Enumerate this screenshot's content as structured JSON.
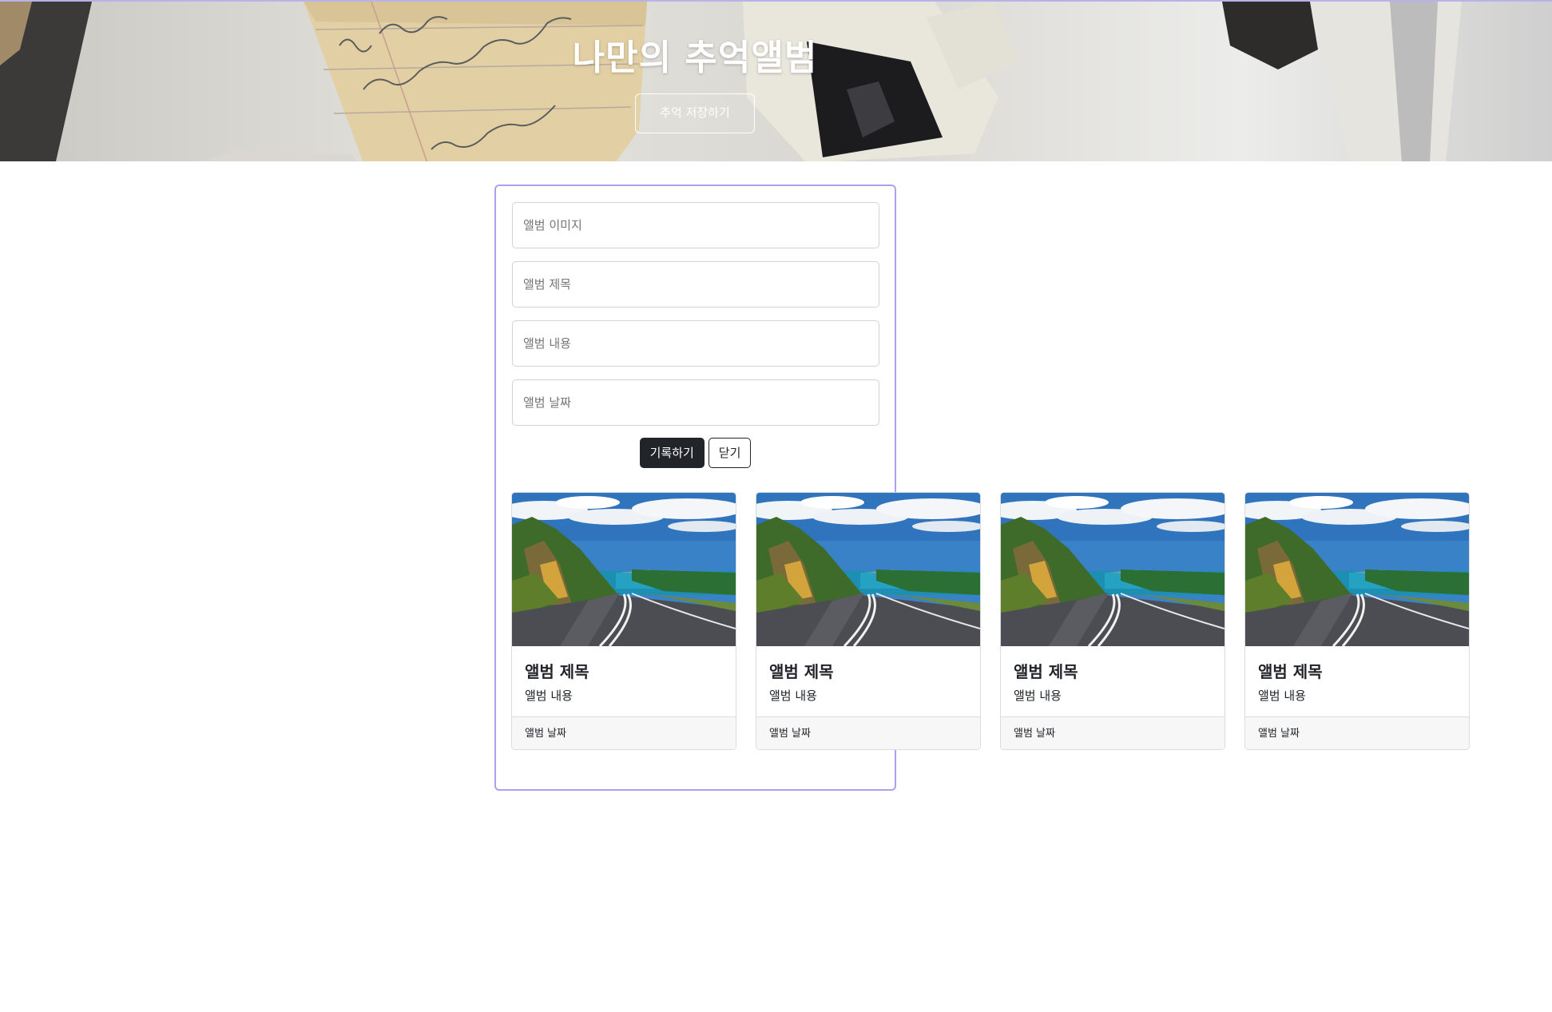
{
  "hero": {
    "title": "나만의 추억앨범",
    "save_button_label": "추억 저장하기"
  },
  "form": {
    "image_placeholder": "앨범 이미지",
    "title_placeholder": "앨범 제목",
    "content_placeholder": "앨범 내용",
    "date_placeholder": "앨범 날짜",
    "submit_label": "기록하기",
    "close_label": "닫기"
  },
  "cards": [
    {
      "title": "앨범 제목",
      "text": "앨범 내용",
      "date": "앨범 날짜"
    },
    {
      "title": "앨범 제목",
      "text": "앨범 내용",
      "date": "앨범 날짜"
    },
    {
      "title": "앨범 제목",
      "text": "앨범 내용",
      "date": "앨범 날짜"
    },
    {
      "title": "앨범 제목",
      "text": "앨범 내용",
      "date": "앨범 날짜"
    }
  ],
  "colors": {
    "form_border": "#a9a2ef",
    "dark_button": "#212529",
    "card_footer_bg": "#f7f7f7"
  }
}
